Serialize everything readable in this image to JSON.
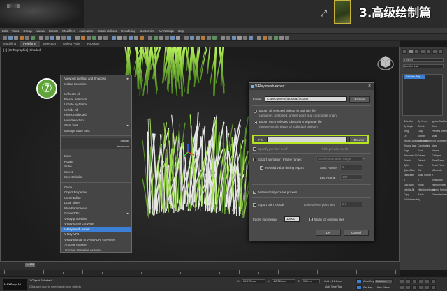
{
  "banner": {
    "chapter_title": "3.高级绘制篇",
    "logo_text": "▓▒░▒▓"
  },
  "menubar": {
    "items": [
      "Edit",
      "Tools",
      "Group",
      "Views",
      "Create",
      "Modifiers",
      "Animation",
      "Graph Editors",
      "Rendering",
      "Customize",
      "MAXScript",
      "Help"
    ]
  },
  "ribbon": {
    "tabs": [
      "Modeling",
      "Freeform",
      "Selection",
      "Object Paint",
      "Populate"
    ]
  },
  "viewport": {
    "label": "[+] [Orthographic] [Shaded]"
  },
  "quad_menu": {
    "step_badge": "⑦",
    "items": [
      {
        "label": "Viewport Lighting and Shadows",
        "arrow": "►"
      },
      {
        "label": "Isolate Selection"
      },
      {
        "sep": true
      },
      {
        "label": "Unfreeze All"
      },
      {
        "label": "Freeze Selection"
      },
      {
        "label": "Unhide by Name"
      },
      {
        "label": "Unhide All"
      },
      {
        "label": "Hide Unselected"
      },
      {
        "label": "Hide Selection"
      },
      {
        "label": "State Sets",
        "arrow": "►"
      },
      {
        "label": "Manage State Sets"
      },
      {
        "sep": true
      },
      {
        "label": "display",
        "right": "display"
      },
      {
        "label": "transform",
        "right": "transform"
      },
      {
        "sep": true
      },
      {
        "label": "Move"
      },
      {
        "label": "Rotate"
      },
      {
        "label": "Scale"
      },
      {
        "label": "Select"
      },
      {
        "label": "Select Similar"
      },
      {
        "sep": true
      },
      {
        "label": "Clone"
      },
      {
        "label": "Object Properties"
      },
      {
        "label": "Curve Editor"
      },
      {
        "label": "Dope Sheet"
      },
      {
        "label": "Wire Parameters"
      },
      {
        "label": "Convert To:",
        "arrow": "►"
      },
      {
        "label": "V-Ray properties"
      },
      {
        "label": "V-Ray scene converter"
      },
      {
        "label": "V-Ray mesh export",
        "selected": true
      },
      {
        "label": "V-Ray VFB"
      },
      {
        "label": "V-Ray Bitmap to VRayHDRI converter"
      },
      {
        "label": ".vrscene exporter"
      },
      {
        "label": ".vrscene animation exporter"
      }
    ]
  },
  "dialog": {
    "title": "V-Ray mesh export",
    "folder_label": "Folder",
    "folder_value": "C:\\Documents\\3dsMax\\export",
    "browse_label": "Browse",
    "radio1_line1": "Export all selected objects in a single file",
    "radio1_line2": "(assumes combined, unwelt point is at coordinate origin)",
    "radio2_line1": "Export each selected object in a separate file",
    "radio2_line2": "(preserves the pivots of individual objects)",
    "file_label": "File",
    "file_value": "",
    "browse2_label": "Browse",
    "specify_label": "Specify preview mesh",
    "pick_label": "Pick preview mesh",
    "export_anim_label": "Export animation",
    "frame_range_label": "Frame range:",
    "frame_range_value": "Scene animation range",
    "motion_blur_label": "Rebuild value during export",
    "start_frame_label": "Start Frame:",
    "start_frame_value": "0",
    "end_frame_label": "End Frame:",
    "end_frame_value": "100",
    "auto_preview_label": "Automatically create proxies",
    "point_cloud_label": "Export point clouds",
    "point_cloud_detail_label": "Lowest level point size",
    "point_cloud_value": "2.0",
    "faces_label": "Faces in preview:",
    "faces_value": "10000",
    "warn_label": "Warn for existing files",
    "ok_label": "OK",
    "cancel_label": "Cancel"
  },
  "command_panel": {
    "name_field": "Line001",
    "modifier_list": "Modifier List",
    "stack_item": "Editable Poly",
    "labels": [
      "Selection",
      "By Vertex",
      "Ignore Backfacing",
      "By Angle",
      "Shrink",
      "Grow",
      "Ring",
      "Loop",
      "Preview Selection",
      "Off",
      "SubObj",
      "Multi",
      "Whole Object Selected",
      "Soft Selection",
      "Edit Geometry",
      "Repeat Last",
      "Constraints",
      "None",
      "Edge",
      "Face",
      "Normal",
      "Preserve UVs",
      "Create",
      "Collapse",
      "Attach",
      "Detach",
      "Slice Plane",
      "Split",
      "Slice",
      "Reset Plane",
      "QuickSlice",
      "Cut",
      "MSmooth",
      "Tessellate",
      "Make Planar",
      "X",
      "Y",
      "Z",
      "View Align",
      "Grid Align",
      "Relax",
      "Hide Selected",
      "Unhide All",
      "Hide Unselected",
      "Named Selections:",
      "Copy",
      "Paste",
      "Delete Isolated Vertices",
      "Full Interactivity"
    ]
  },
  "timeline": {
    "slider_label": "0 / 100"
  },
  "status": {
    "maxscript_label": "MAXScript Mi",
    "objects_selected": "1 Object Selected",
    "prompt": "Click and drag to select and move objects",
    "x_label": "X:",
    "x_value": "80.578mm",
    "y_label": "Y:",
    "y_value": "-12.360mm",
    "z_label": "Z:",
    "z_value": "0.0mm",
    "grid_label": "Grid = 10.0mm",
    "autokey_label": "Auto Key",
    "selected_label": "Selected",
    "setkey_label": "Set Key",
    "keyfilters_label": "Key Filters...",
    "add_time_tag": "Add Time Tag"
  },
  "colors": {
    "accent_blue": "#3d7fd4",
    "highlight_green": "#b6e41f",
    "badge_green": "#5fa53a",
    "grass_green": "#8fe03a"
  }
}
